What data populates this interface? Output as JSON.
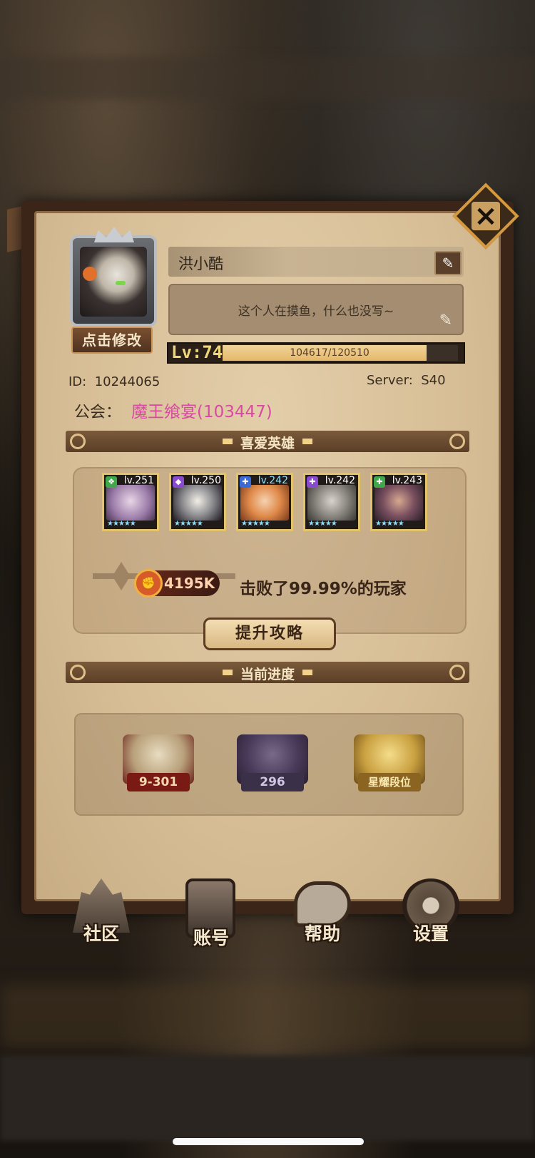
{
  "profile": {
    "edit_avatar_label": "点击修改",
    "name": "洪小酷",
    "signature": "这个人在摸鱼，什么也没写~",
    "level_label": "Lv:74",
    "exp_text": "104617/120510",
    "exp_fraction": 0.868,
    "id_label": "ID:",
    "id_value": "10244065",
    "server_label": "Server:",
    "server_value": "S40",
    "guild_label": "公会：",
    "guild_name": "魔王飨宴(103447)"
  },
  "favorite_heroes": {
    "title": "喜爱英雄",
    "heroes": [
      {
        "level": "lv.251",
        "element": "wind",
        "stars": "★★★★★",
        "color": "#3ea84a"
      },
      {
        "level": "lv.250",
        "element": "dark",
        "stars": "★★★★★",
        "color": "#8a4ad0"
      },
      {
        "level": "lv.242",
        "element": "light",
        "stars": "★★★★★",
        "color": "#3a6ad8"
      },
      {
        "level": "lv.242",
        "element": "dark",
        "stars": "★★★★★",
        "color": "#8a4ad0"
      },
      {
        "level": "lv.243",
        "element": "wind",
        "stars": "★★★★★",
        "color": "#3ea84a"
      }
    ]
  },
  "power": {
    "value": "4195K",
    "defeat_text": "击败了99.99%的玩家",
    "strategy_button": "提升攻略"
  },
  "progress": {
    "title": "当前进度",
    "items": [
      {
        "caption": "9-301",
        "icon": "campaign-book-icon"
      },
      {
        "caption": "296",
        "icon": "tower-icon"
      },
      {
        "caption": "星耀段位",
        "icon": "arena-rank-icon"
      }
    ]
  },
  "nav": {
    "community": "社区",
    "account": "账号",
    "help": "帮助",
    "settings": "设置"
  },
  "colors": {
    "guild_name": "#d84aa2",
    "accent_gold": "#e3c46a",
    "panel_bg": "#d6bd95"
  }
}
